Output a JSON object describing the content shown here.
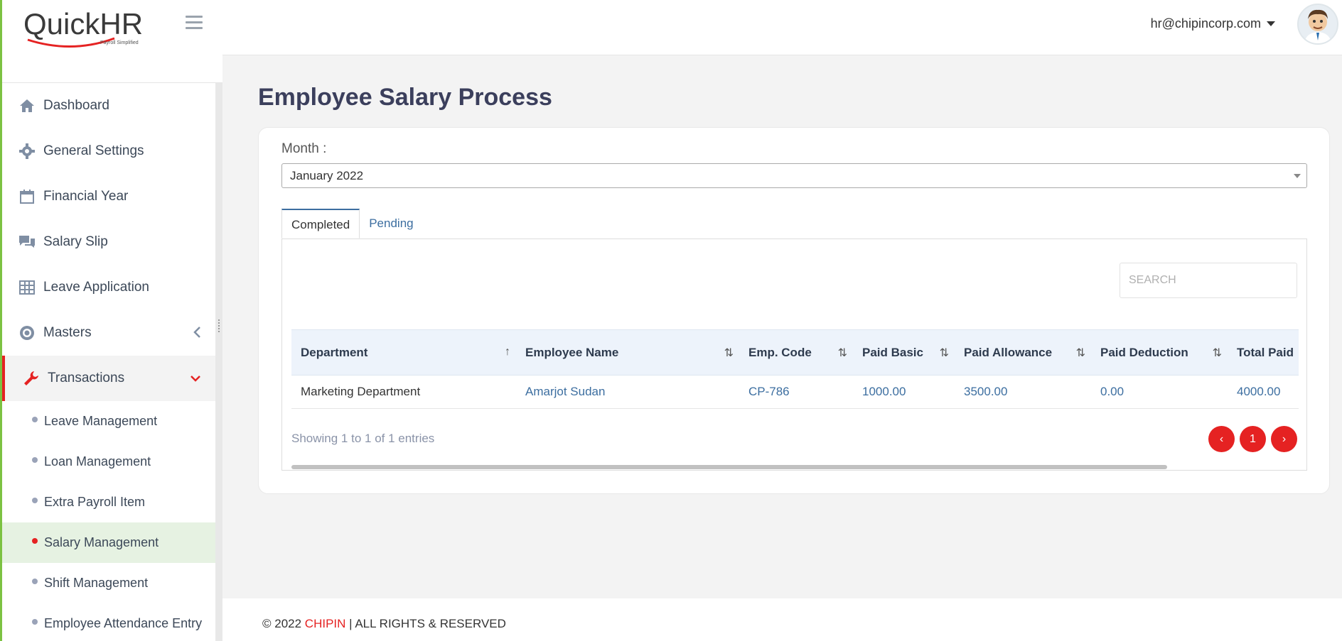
{
  "app": {
    "logo_text": "QuickHR",
    "logo_tagline": "Payroll Simplified"
  },
  "sidebar": {
    "items": [
      {
        "label": "Dashboard",
        "icon": "home-icon"
      },
      {
        "label": "General Settings",
        "icon": "gear-icon"
      },
      {
        "label": "Financial Year",
        "icon": "calendar-icon"
      },
      {
        "label": "Salary Slip",
        "icon": "chat-icon"
      },
      {
        "label": "Leave Application",
        "icon": "table-icon"
      },
      {
        "label": "Masters",
        "icon": "cog-badge-icon"
      },
      {
        "label": "Transactions",
        "icon": "wrench-icon"
      }
    ],
    "sub_items": [
      {
        "label": "Leave Management"
      },
      {
        "label": "Loan Management"
      },
      {
        "label": "Extra Payroll Item"
      },
      {
        "label": "Salary Management"
      },
      {
        "label": "Shift Management"
      },
      {
        "label": "Employee Attendance Entry"
      }
    ]
  },
  "header": {
    "user_email": "hr@chipincorp.com"
  },
  "main": {
    "title": "Employee Salary Process",
    "month_label": "Month :",
    "month_value": "January 2022",
    "tabs": [
      {
        "label": "Completed"
      },
      {
        "label": "Pending"
      }
    ],
    "search_placeholder": "SEARCH",
    "table": {
      "columns": [
        "Department",
        "Employee Name",
        "Emp. Code",
        "Paid Basic",
        "Paid Allowance",
        "Paid Deduction",
        "Total Paid"
      ],
      "rows": [
        [
          "Marketing Department",
          "Amarjot Sudan",
          "CP-786",
          "1000.00",
          "3500.00",
          "0.00",
          "4000.00"
        ]
      ]
    },
    "showing_text": "Showing 1 to 1 of 1 entries",
    "pager": {
      "prev": "‹",
      "page": "1",
      "next": "›"
    }
  },
  "footer": {
    "prefix": "© 2022 ",
    "brand": "CHIPIN",
    "suffix": " | ALL RIGHTS & RESERVED"
  },
  "colors": {
    "accent_red": "#e52222",
    "accent_green": "#7cc242",
    "link_blue": "#3c6ea0"
  }
}
